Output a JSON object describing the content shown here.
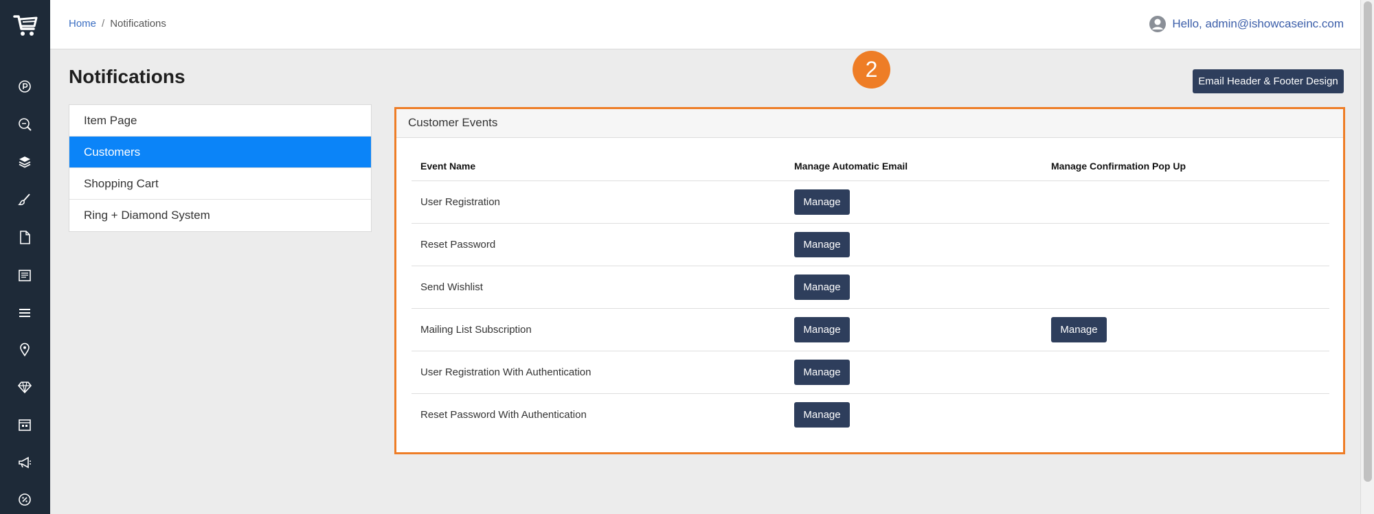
{
  "breadcrumb": {
    "home": "Home",
    "separator": "/",
    "current": "Notifications"
  },
  "user": {
    "greeting": "Hello, admin@ishowcaseinc.com"
  },
  "page": {
    "title": "Notifications",
    "header_footer_button": "Email Header & Footer Design",
    "step_badge": "2"
  },
  "menu": {
    "items": [
      {
        "label": "Item Page"
      },
      {
        "label": "Customers",
        "active": true
      },
      {
        "label": "Shopping Cart"
      },
      {
        "label": "Ring + Diamond System"
      }
    ]
  },
  "panel": {
    "title": "Customer Events",
    "columns": [
      "Event Name",
      "Manage Automatic Email",
      "Manage Confirmation Pop Up"
    ],
    "rows": [
      {
        "event": "User Registration",
        "email_button": "Manage",
        "popup_button": ""
      },
      {
        "event": "Reset Password",
        "email_button": "Manage",
        "popup_button": ""
      },
      {
        "event": "Send Wishlist",
        "email_button": "Manage",
        "popup_button": ""
      },
      {
        "event": "Mailing List Subscription",
        "email_button": "Manage",
        "popup_button": "Manage"
      },
      {
        "event": "User Registration With Authentication",
        "email_button": "Manage",
        "popup_button": ""
      },
      {
        "event": "Reset Password With Authentication",
        "email_button": "Manage",
        "popup_button": ""
      }
    ]
  },
  "colors": {
    "sidebar": "#1e2a38",
    "accent": "#0b84f8",
    "button": "#2e3e5c",
    "highlight": "#ee7d26"
  },
  "sidebar_icons": [
    "cart-logo-icon",
    "parking-icon",
    "search-seo-icon",
    "layers-icon",
    "brush-icon",
    "document-icon",
    "news-icon",
    "menu-lines-icon",
    "location-pin-icon",
    "diamond-icon",
    "calendar-icon",
    "megaphone-icon",
    "percent-badge-icon"
  ]
}
